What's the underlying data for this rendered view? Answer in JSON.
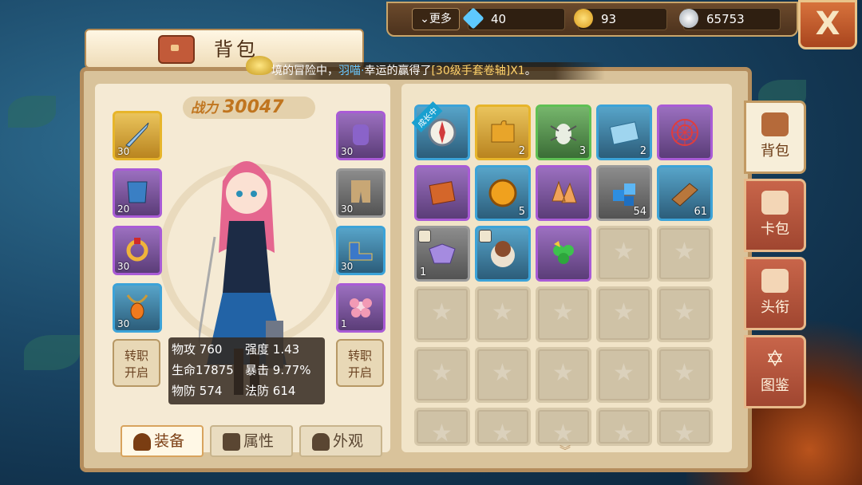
{
  "topbar": {
    "more_label": "更多",
    "currencies": [
      {
        "icon": "diamond-icon",
        "value": "40",
        "color": "#5ec9ff"
      },
      {
        "icon": "gold-coin-icon",
        "value": "93",
        "color": "#f2b52a"
      },
      {
        "icon": "silver-coin-icon",
        "value": "65753",
        "color": "#d9dde3"
      }
    ],
    "close_label": "X"
  },
  "title": "背包",
  "notice": {
    "prefix": "境的冒险中，",
    "player": "羽喵·",
    "middle": "幸运的赢得了",
    "item": "[30级手套卷轴]X1",
    "suffix": "。"
  },
  "hero": {
    "power_label": "战力",
    "power_value": "30047",
    "left_slots": [
      {
        "name": "weapon-slot",
        "icon": "sword-icon",
        "count": "30",
        "quality": "gold"
      },
      {
        "name": "armor-slot",
        "icon": "armor-icon",
        "count": "20",
        "quality": "purple"
      },
      {
        "name": "ring-slot",
        "icon": "ring-icon",
        "count": "30",
        "quality": "purple"
      },
      {
        "name": "necklace-slot",
        "icon": "necklace-icon",
        "count": "30",
        "quality": "blue"
      }
    ],
    "right_slots": [
      {
        "name": "gloves-slot",
        "icon": "gloves-icon",
        "count": "30",
        "quality": "purple"
      },
      {
        "name": "pants-slot",
        "icon": "pants-icon",
        "count": "30",
        "quality": "gray"
      },
      {
        "name": "boots-slot",
        "icon": "boots-icon",
        "count": "30",
        "quality": "blue"
      },
      {
        "name": "flower-slot",
        "icon": "flower-icon",
        "count": "1",
        "quality": "purple"
      }
    ],
    "job_change_left": [
      "转职",
      "开启"
    ],
    "job_change_right": [
      "转职",
      "开启"
    ],
    "stats": [
      {
        "label": "物攻",
        "value": "760"
      },
      {
        "label": "强度",
        "value": "1.43"
      },
      {
        "label": "生命",
        "value": "17875"
      },
      {
        "label": "暴击",
        "value": "9.77%"
      },
      {
        "label": "物防",
        "value": "574"
      },
      {
        "label": "法防",
        "value": "614"
      }
    ],
    "tabs": [
      {
        "label": "装备",
        "icon": "helmet-icon",
        "active": true
      },
      {
        "label": "属性",
        "icon": "attribute-icon",
        "active": false
      },
      {
        "label": "外观",
        "icon": "outfit-icon",
        "active": false
      }
    ]
  },
  "bag": {
    "items": [
      {
        "icon": "compass-icon",
        "count": "",
        "quality": "blue",
        "tag": "成长中"
      },
      {
        "icon": "puzzle-icon",
        "count": "2",
        "quality": "gold"
      },
      {
        "icon": "bug-icon",
        "count": "3",
        "quality": "green"
      },
      {
        "icon": "ticket-icon",
        "count": "2",
        "quality": "blue"
      },
      {
        "icon": "web-icon",
        "count": "",
        "quality": "purple"
      },
      {
        "icon": "book-icon",
        "count": "",
        "quality": "purple"
      },
      {
        "icon": "coin-icon",
        "count": "5",
        "quality": "blue"
      },
      {
        "icon": "crystal-shard-icon",
        "count": "",
        "quality": "purple"
      },
      {
        "icon": "ice-cube-icon",
        "count": "54",
        "quality": "gray"
      },
      {
        "icon": "bronze-bar-icon",
        "count": "61",
        "quality": "blue"
      },
      {
        "icon": "mask-icon",
        "count": "1",
        "quality": "gray",
        "locked": true
      },
      {
        "icon": "hamster-pet-icon",
        "count": "",
        "quality": "blue",
        "locked": true
      },
      {
        "icon": "clover-icon",
        "count": "",
        "quality": "purple"
      }
    ],
    "tag_label": "成长中",
    "scroll_glyph": "︾"
  },
  "side_tabs": [
    {
      "label": "背包",
      "icon": "bag-icon",
      "active": true
    },
    {
      "label": "卡包",
      "icon": "card-pack-icon",
      "active": false
    },
    {
      "label": "头衔",
      "icon": "title-scroll-icon",
      "active": false
    },
    {
      "label": "图鉴",
      "icon": "star-of-david-icon",
      "active": false
    }
  ]
}
